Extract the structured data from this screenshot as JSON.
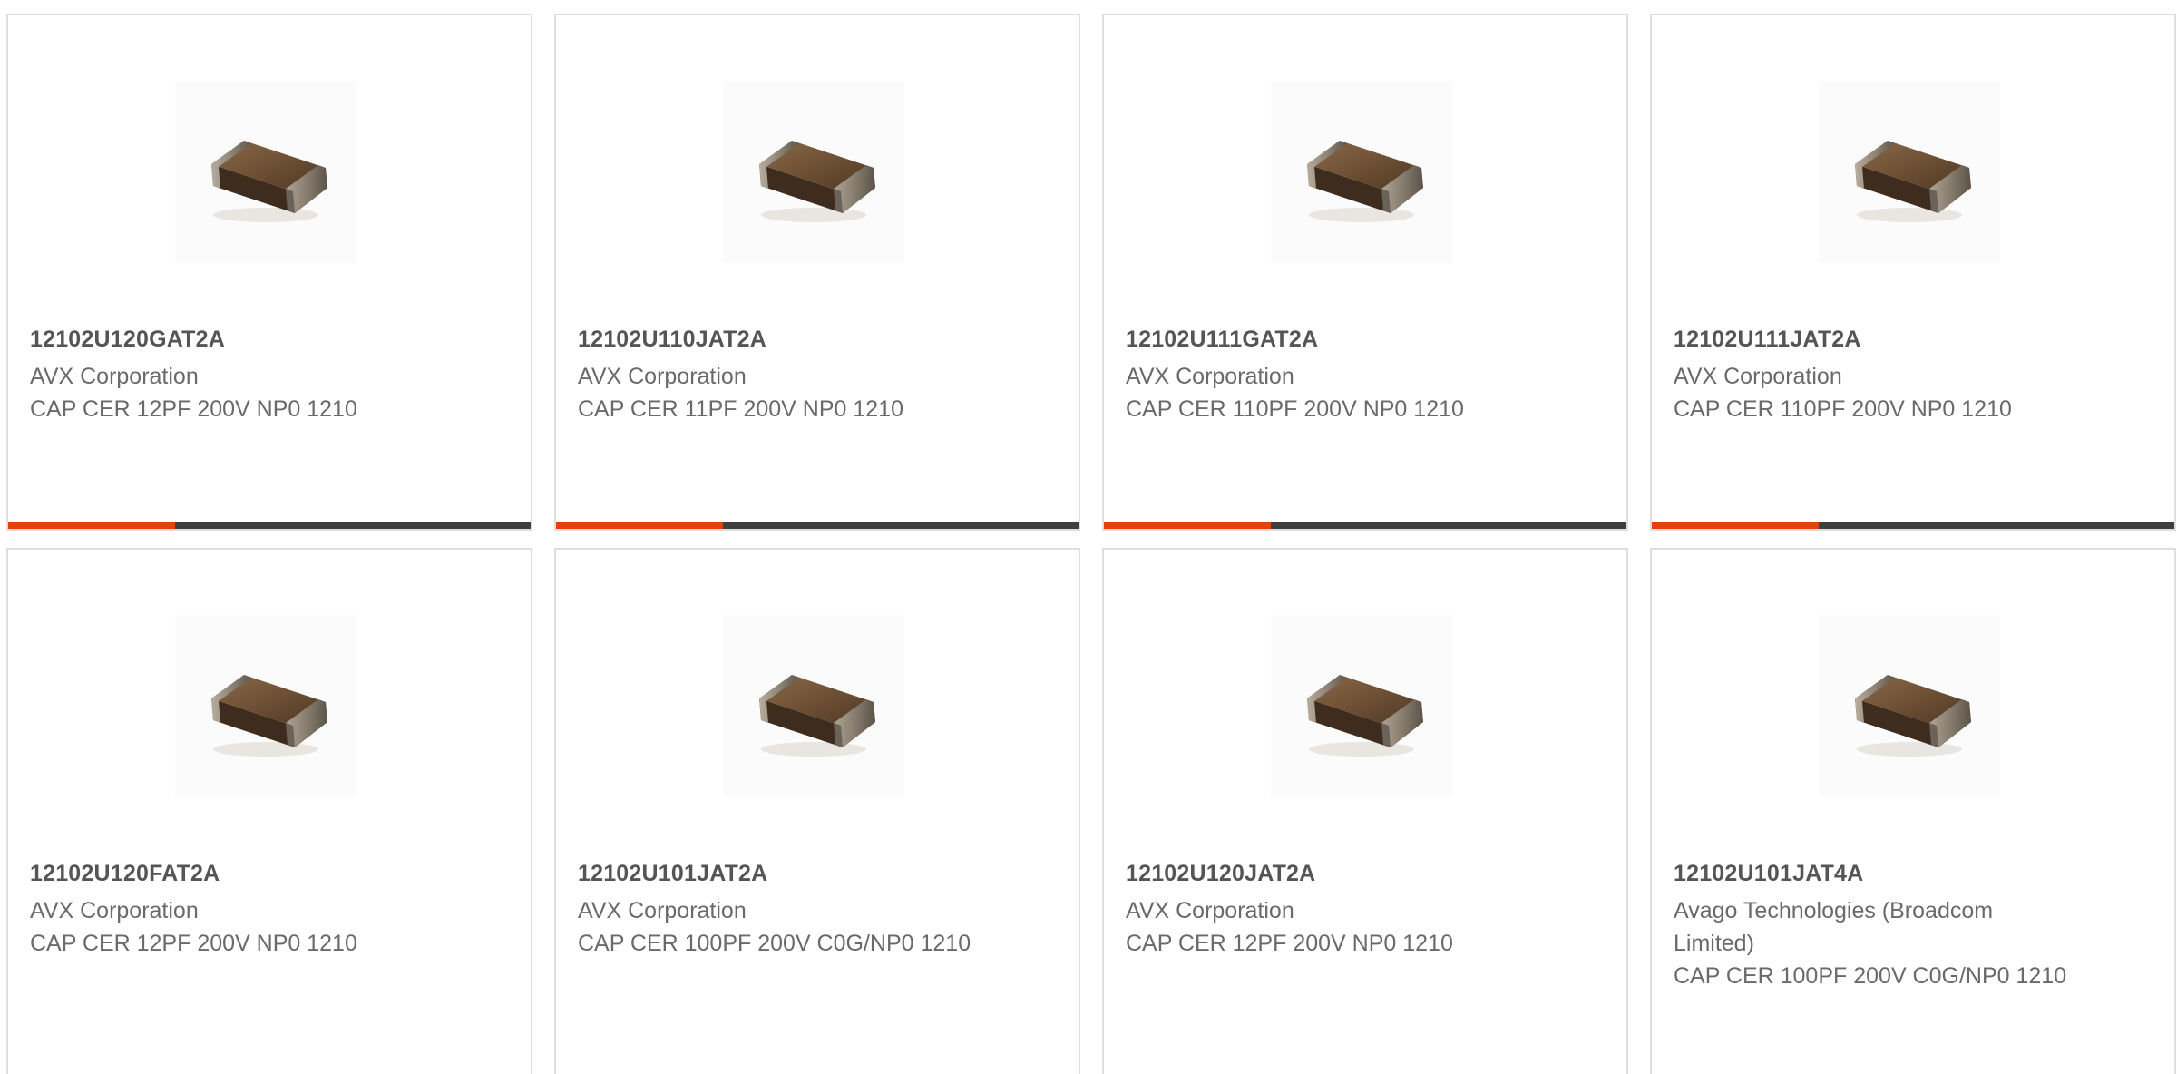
{
  "colors": {
    "accent": "#e8400e",
    "track": "#3f3f3f",
    "card_border": "#dedede",
    "text": "#555555"
  },
  "products": [
    {
      "part_number": "12102U120GAT2A",
      "manufacturer": "AVX Corporation",
      "description": "CAP CER 12PF 200V NP0 1210",
      "image": "ceramic-capacitor-chip-image",
      "progress": 0.32
    },
    {
      "part_number": "12102U110JAT2A",
      "manufacturer": "AVX Corporation",
      "description": "CAP CER 11PF 200V NP0 1210",
      "image": "ceramic-capacitor-chip-image",
      "progress": 0.32
    },
    {
      "part_number": "12102U111GAT2A",
      "manufacturer": "AVX Corporation",
      "description": "CAP CER 110PF 200V NP0 1210",
      "image": "ceramic-capacitor-chip-image",
      "progress": 0.32
    },
    {
      "part_number": "12102U111JAT2A",
      "manufacturer": "AVX Corporation",
      "description": "CAP CER 110PF 200V NP0 1210",
      "image": "ceramic-capacitor-chip-image",
      "progress": 0.32
    },
    {
      "part_number": "12102U120FAT2A",
      "manufacturer": "AVX Corporation",
      "description": "CAP CER 12PF 200V NP0 1210",
      "image": "ceramic-capacitor-chip-image"
    },
    {
      "part_number": "12102U101JAT2A",
      "manufacturer": "AVX Corporation",
      "description": "CAP CER 100PF 200V C0G/NP0 1210",
      "image": "ceramic-capacitor-chip-image"
    },
    {
      "part_number": "12102U120JAT2A",
      "manufacturer": "AVX Corporation",
      "description": "CAP CER 12PF 200V NP0 1210",
      "image": "ceramic-capacitor-chip-image"
    },
    {
      "part_number": "12102U101JAT4A",
      "manufacturer": "Avago Technologies (Broadcom Limited)",
      "description": "CAP CER 100PF 200V C0G/NP0 1210",
      "image": "ceramic-capacitor-chip-image"
    }
  ]
}
